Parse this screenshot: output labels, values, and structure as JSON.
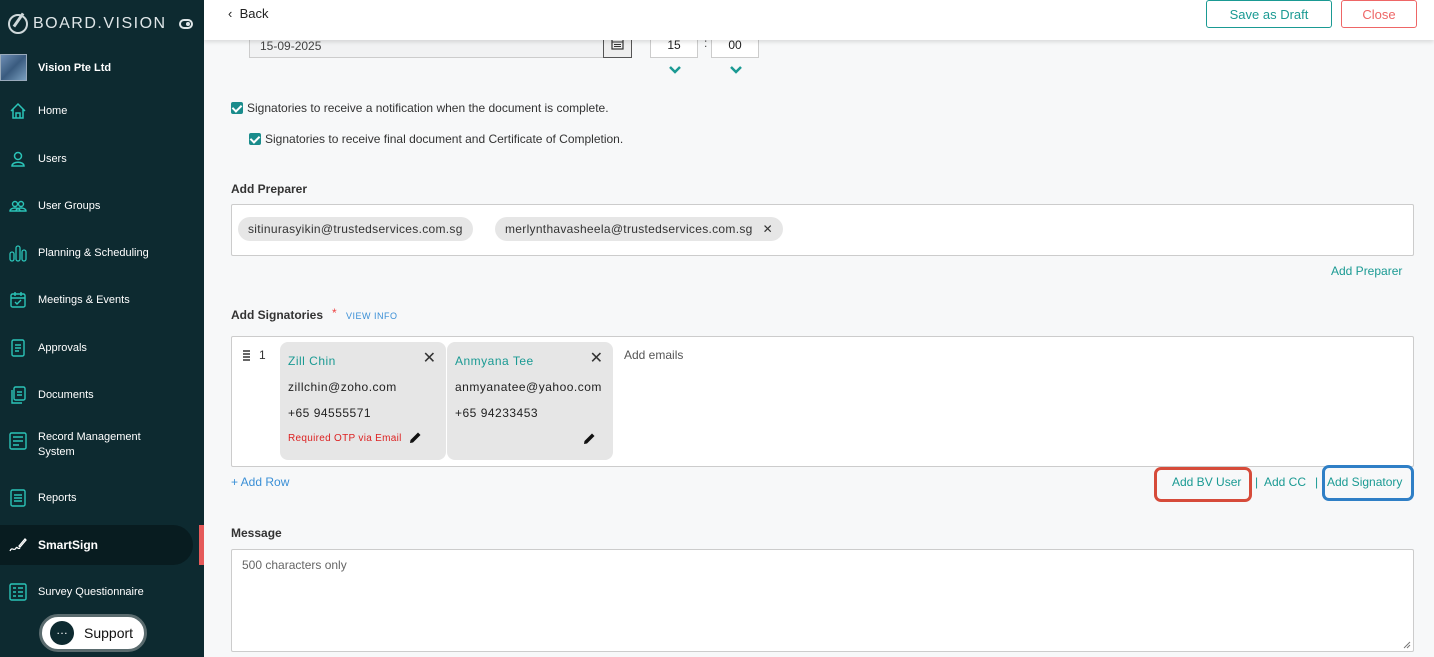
{
  "sidebar": {
    "brand": "BOARD.VISION",
    "org_name": "Vision Pte Ltd",
    "items": [
      {
        "label": "Home",
        "icon": "home-icon"
      },
      {
        "label": "Users",
        "icon": "user-icon"
      },
      {
        "label": "User Groups",
        "icon": "user-group-icon"
      },
      {
        "label": "Planning & Scheduling",
        "icon": "bar-chart-icon"
      },
      {
        "label": "Meetings & Events",
        "icon": "calendar-icon"
      },
      {
        "label": "Approvals",
        "icon": "approval-doc-icon"
      },
      {
        "label": "Documents",
        "icon": "documents-icon"
      },
      {
        "label": "Record Management System",
        "icon": "record-icon"
      },
      {
        "label": "Reports",
        "icon": "report-icon"
      },
      {
        "label": "SmartSign",
        "icon": "signature-icon",
        "active": true
      },
      {
        "label": "Survey Questionnaire",
        "icon": "survey-icon"
      }
    ],
    "support_label": "Support"
  },
  "topbar": {
    "back_label": "Back",
    "save_draft_label": "Save as Draft",
    "close_label": "Close"
  },
  "schedule": {
    "date": "15-09-2025",
    "hour": "15",
    "minute": "00"
  },
  "options": {
    "notify_label": "Signatories to receive a notification when the document is complete.",
    "final_doc_label": "Signatories to receive final document and Certificate of Completion."
  },
  "preparer": {
    "title": "Add Preparer",
    "chips": [
      "sitinurasyikin@trustedservices.com.sg",
      "merlynthavasheela@trustedservices.com.sg"
    ],
    "add_link": "Add Preparer"
  },
  "signatories": {
    "title": "Add Signatories",
    "required_mark": "*",
    "view_info": "VIEW INFO",
    "row_number": "1",
    "add_emails_placeholder": "Add emails",
    "cards": [
      {
        "name": "Zill Chin",
        "email": "zillchin@zoho.com",
        "phone": "+65 94555571",
        "note": "Required OTP via Email"
      },
      {
        "name": "Anmyana Tee",
        "email": "anmyanatee@yahoo.com",
        "phone": "+65 94233453",
        "note": ""
      }
    ],
    "add_row": "+ Add Row",
    "add_bv_user": "Add BV User",
    "add_cc": "Add CC",
    "add_signatory": "Add Signatory",
    "separator": "|"
  },
  "message": {
    "title": "Message",
    "placeholder": "500 characters only"
  },
  "colors": {
    "sidebar_bg": "#0d2a30",
    "accent": "#1a9a93",
    "danger": "#e66666",
    "highlight_red": "#d64b3a",
    "highlight_blue": "#2f7fc6"
  }
}
